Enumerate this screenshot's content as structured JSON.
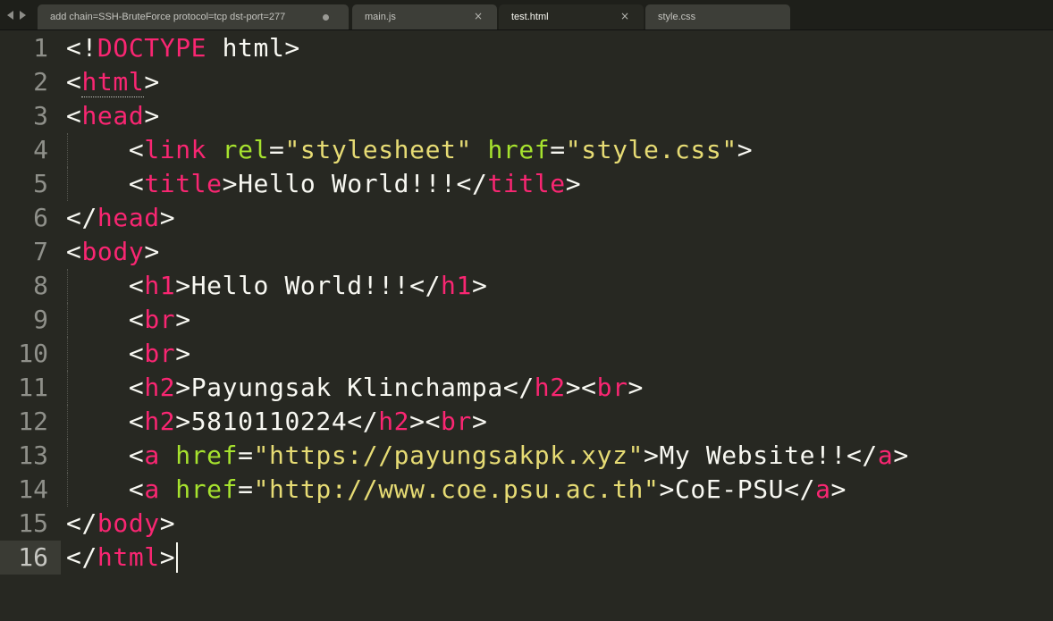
{
  "tabs": [
    {
      "label": "add chain=SSH-BruteForce protocol=tcp dst-port=277",
      "active": false,
      "modified": true
    },
    {
      "label": "main.js",
      "active": false,
      "modified": false
    },
    {
      "label": "test.html",
      "active": true,
      "modified": false
    },
    {
      "label": "style.css",
      "active": false,
      "modified": false
    }
  ],
  "tab_close_glyph": "×",
  "current_line": 16,
  "colors": {
    "background": "#272822",
    "tag": "#f92672",
    "attribute": "#a6e22e",
    "string": "#e6db74",
    "text": "#f8f8f2",
    "gutter": "#8f908a"
  },
  "lines": [
    {
      "n": "1",
      "indent": false,
      "tokens": [
        [
          "punc",
          "<!"
        ],
        [
          "doctype",
          "DOCTYPE"
        ],
        [
          "text",
          " html"
        ],
        [
          "punc",
          ">"
        ]
      ]
    },
    {
      "n": "2",
      "indent": false,
      "tokens": [
        [
          "punc",
          "<"
        ],
        [
          "tag_u",
          "html"
        ],
        [
          "punc",
          ">"
        ]
      ]
    },
    {
      "n": "3",
      "indent": false,
      "tokens": [
        [
          "punc",
          "<"
        ],
        [
          "tag",
          "head"
        ],
        [
          "punc",
          ">"
        ]
      ]
    },
    {
      "n": "4",
      "indent": true,
      "tokens": [
        [
          "text",
          "    "
        ],
        [
          "punc",
          "<"
        ],
        [
          "tag",
          "link"
        ],
        [
          "text",
          " "
        ],
        [
          "attr",
          "rel"
        ],
        [
          "punc",
          "="
        ],
        [
          "str",
          "\"stylesheet\""
        ],
        [
          "text",
          " "
        ],
        [
          "attr",
          "href"
        ],
        [
          "punc",
          "="
        ],
        [
          "str",
          "\"style.css\""
        ],
        [
          "punc",
          ">"
        ]
      ]
    },
    {
      "n": "5",
      "indent": true,
      "tokens": [
        [
          "text",
          "    "
        ],
        [
          "punc",
          "<"
        ],
        [
          "tag",
          "title"
        ],
        [
          "punc",
          ">"
        ],
        [
          "text",
          "Hello World!!!"
        ],
        [
          "punc",
          "</"
        ],
        [
          "tag",
          "title"
        ],
        [
          "punc",
          ">"
        ]
      ]
    },
    {
      "n": "6",
      "indent": false,
      "tokens": [
        [
          "punc",
          "</"
        ],
        [
          "tag",
          "head"
        ],
        [
          "punc",
          ">"
        ]
      ]
    },
    {
      "n": "7",
      "indent": false,
      "tokens": [
        [
          "punc",
          "<"
        ],
        [
          "tag",
          "body"
        ],
        [
          "punc",
          ">"
        ]
      ]
    },
    {
      "n": "8",
      "indent": true,
      "tokens": [
        [
          "text",
          "    "
        ],
        [
          "punc",
          "<"
        ],
        [
          "tag",
          "h1"
        ],
        [
          "punc",
          ">"
        ],
        [
          "text",
          "Hello World!!!"
        ],
        [
          "punc",
          "</"
        ],
        [
          "tag",
          "h1"
        ],
        [
          "punc",
          ">"
        ]
      ]
    },
    {
      "n": "9",
      "indent": true,
      "tokens": [
        [
          "text",
          "    "
        ],
        [
          "punc",
          "<"
        ],
        [
          "tag",
          "br"
        ],
        [
          "punc",
          ">"
        ]
      ]
    },
    {
      "n": "10",
      "indent": true,
      "tokens": [
        [
          "text",
          "    "
        ],
        [
          "punc",
          "<"
        ],
        [
          "tag",
          "br"
        ],
        [
          "punc",
          ">"
        ]
      ]
    },
    {
      "n": "11",
      "indent": true,
      "tokens": [
        [
          "text",
          "    "
        ],
        [
          "punc",
          "<"
        ],
        [
          "tag",
          "h2"
        ],
        [
          "punc",
          ">"
        ],
        [
          "text",
          "Payungsak Klinchampa"
        ],
        [
          "punc",
          "</"
        ],
        [
          "tag",
          "h2"
        ],
        [
          "punc",
          "><"
        ],
        [
          "tag",
          "br"
        ],
        [
          "punc",
          ">"
        ]
      ]
    },
    {
      "n": "12",
      "indent": true,
      "tokens": [
        [
          "text",
          "    "
        ],
        [
          "punc",
          "<"
        ],
        [
          "tag",
          "h2"
        ],
        [
          "punc",
          ">"
        ],
        [
          "text",
          "5810110224"
        ],
        [
          "punc",
          "</"
        ],
        [
          "tag",
          "h2"
        ],
        [
          "punc",
          "><"
        ],
        [
          "tag",
          "br"
        ],
        [
          "punc",
          ">"
        ]
      ]
    },
    {
      "n": "13",
      "indent": true,
      "tokens": [
        [
          "text",
          "    "
        ],
        [
          "punc",
          "<"
        ],
        [
          "tag",
          "a"
        ],
        [
          "text",
          " "
        ],
        [
          "attr",
          "href"
        ],
        [
          "punc",
          "="
        ],
        [
          "str",
          "\"https://payungsakpk.xyz\""
        ],
        [
          "punc",
          ">"
        ],
        [
          "text",
          "My Website!!"
        ],
        [
          "punc",
          "</"
        ],
        [
          "tag",
          "a"
        ],
        [
          "punc",
          ">"
        ]
      ]
    },
    {
      "n": "14",
      "indent": true,
      "tokens": [
        [
          "text",
          "    "
        ],
        [
          "punc",
          "<"
        ],
        [
          "tag",
          "a"
        ],
        [
          "text",
          " "
        ],
        [
          "attr",
          "href"
        ],
        [
          "punc",
          "="
        ],
        [
          "str",
          "\"http://www.coe.psu.ac.th\""
        ],
        [
          "punc",
          ">"
        ],
        [
          "text",
          "CoE-PSU"
        ],
        [
          "punc",
          "</"
        ],
        [
          "tag",
          "a"
        ],
        [
          "punc",
          ">"
        ]
      ]
    },
    {
      "n": "15",
      "indent": false,
      "tokens": [
        [
          "punc",
          "</"
        ],
        [
          "tag",
          "body"
        ],
        [
          "punc",
          ">"
        ]
      ]
    },
    {
      "n": "16",
      "indent": false,
      "tokens": [
        [
          "punc",
          "</"
        ],
        [
          "tag",
          "html"
        ],
        [
          "punc",
          ">"
        ]
      ],
      "cursor": true
    }
  ]
}
